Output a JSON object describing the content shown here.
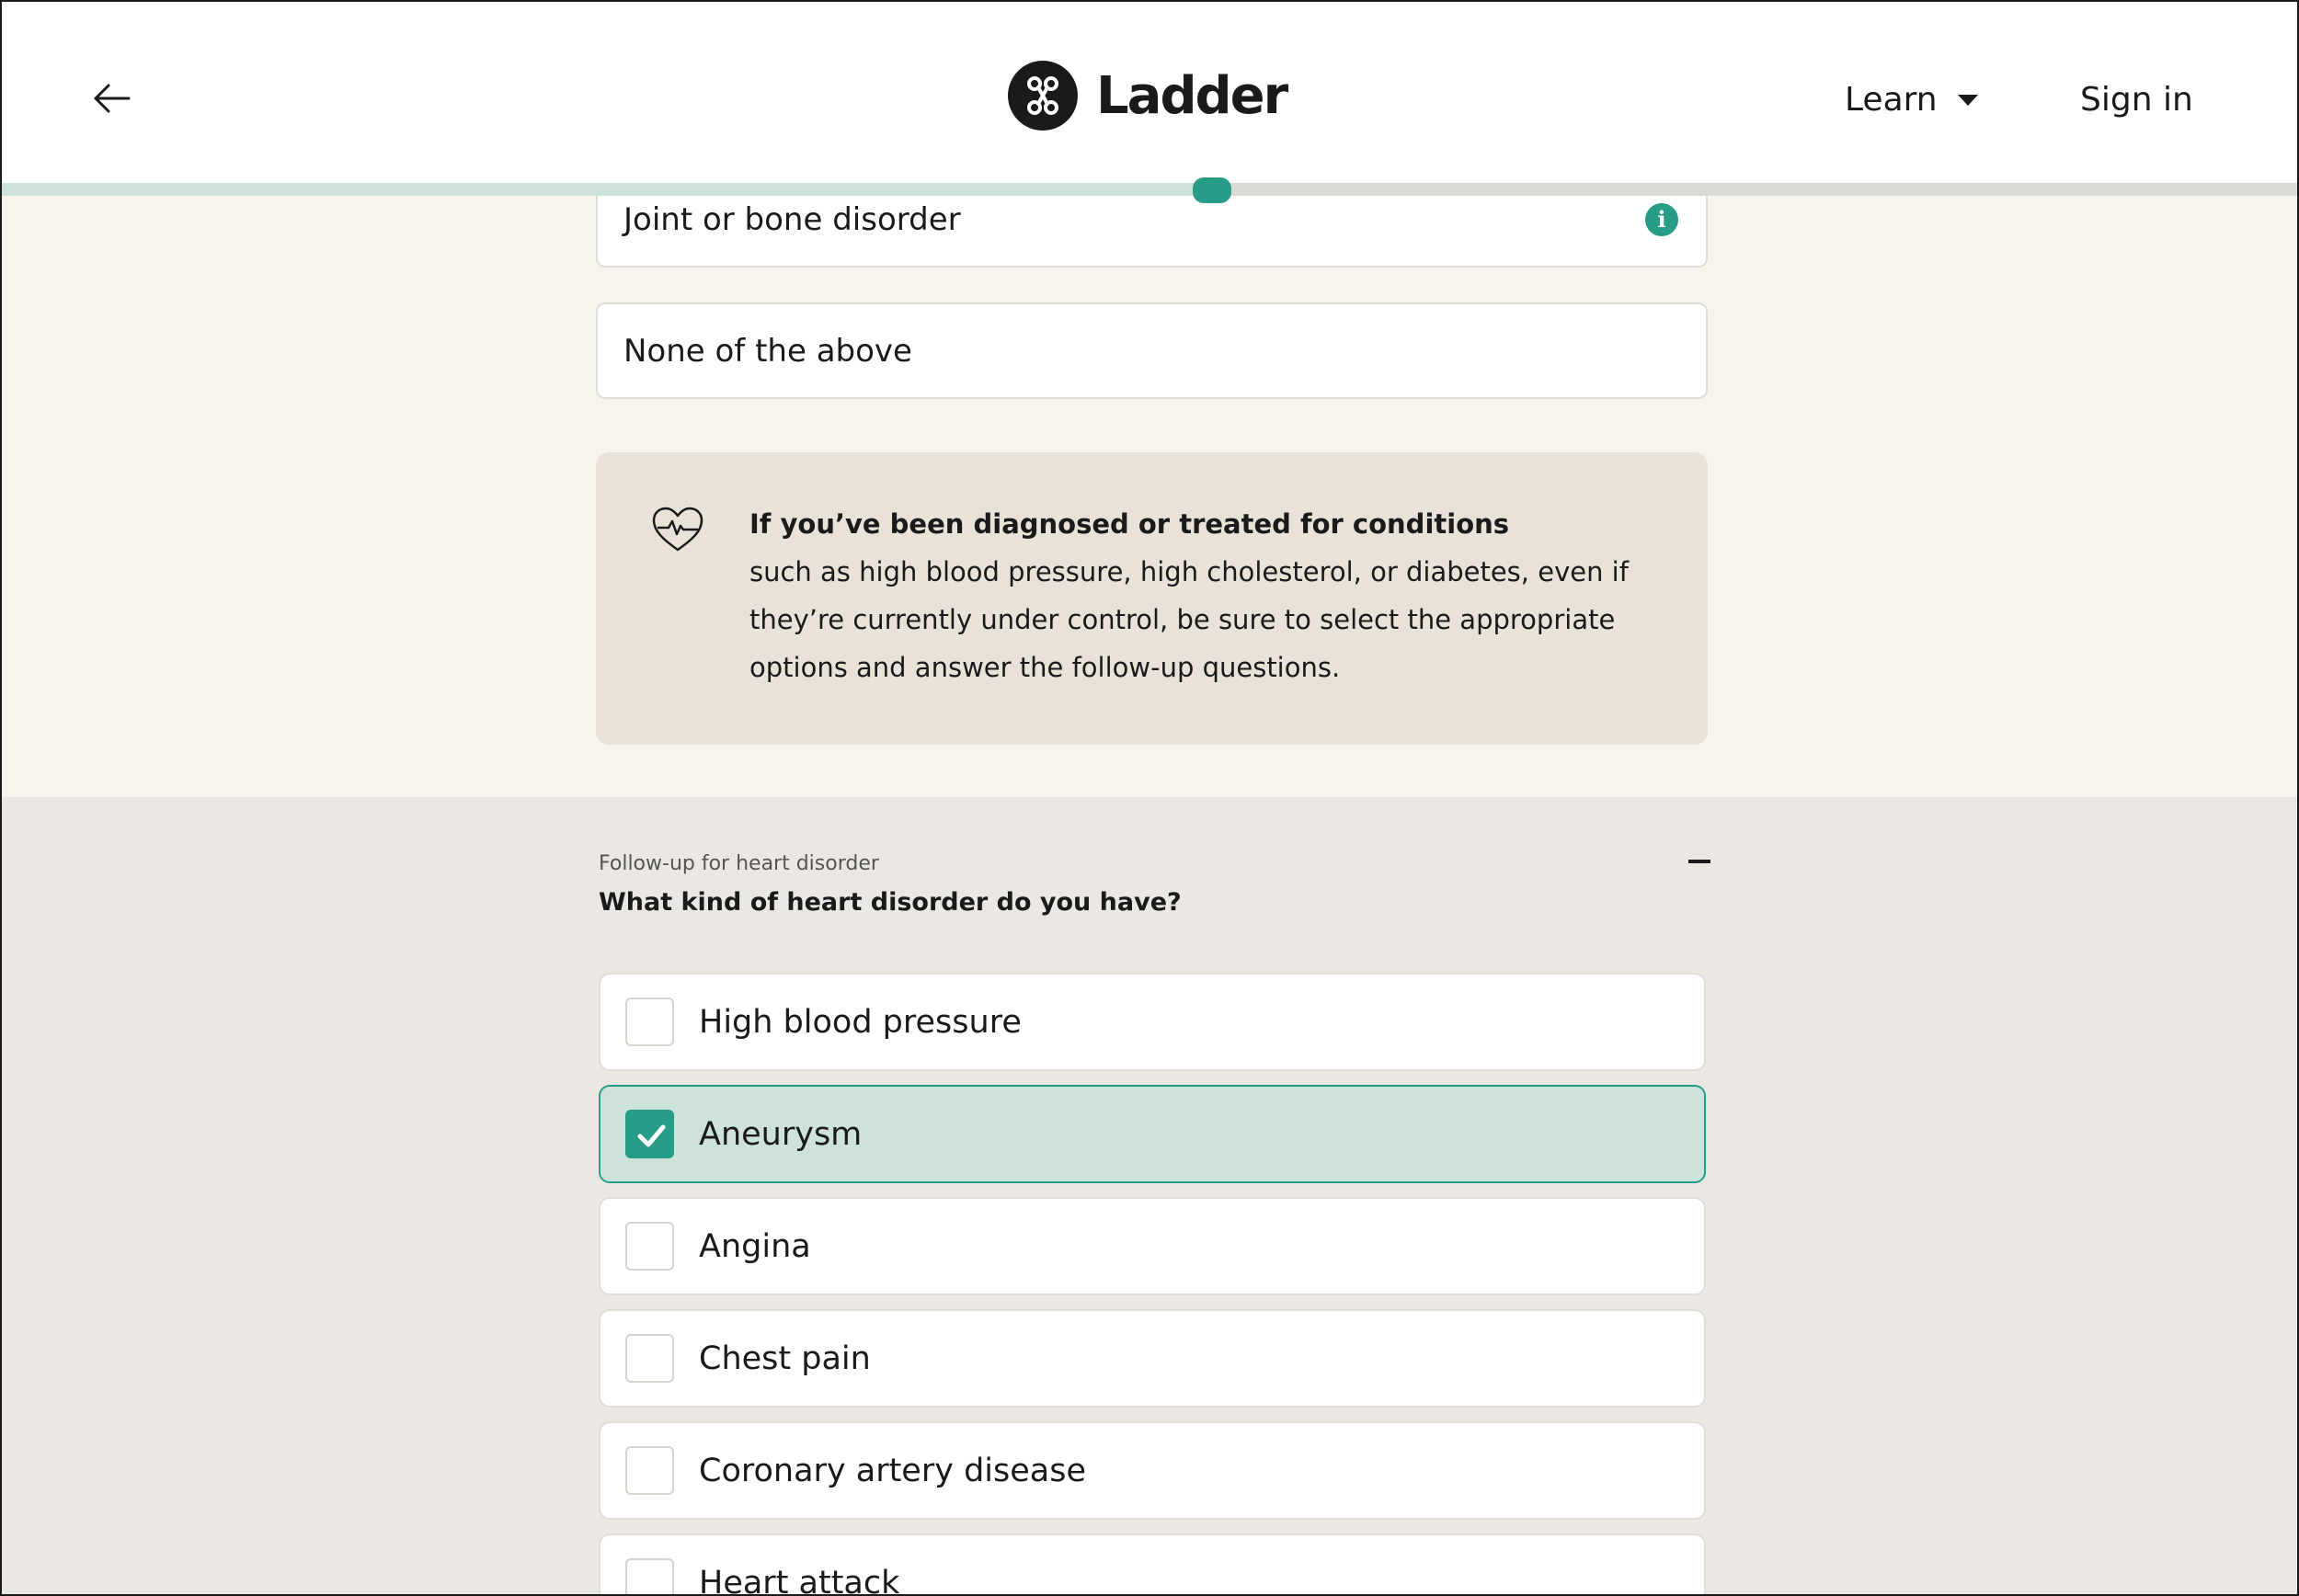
{
  "header": {
    "brand": "Ladder",
    "nav_learn": "Learn",
    "nav_signin": "Sign in"
  },
  "progress": {
    "fraction": 0.527
  },
  "conditions": {
    "options": [
      {
        "label": "Joint or bone disorder",
        "has_info": true
      },
      {
        "label": "None of the above",
        "has_info": false
      }
    ]
  },
  "notice": {
    "title": "If you’ve been diagnosed or treated for conditions",
    "body": "such as high blood pressure, high cholesterol, or diabetes, even if they’re currently under control, be sure to select the appropriate options and answer the follow-up questions."
  },
  "followup": {
    "label": "Follow-up for heart disorder",
    "question": "What kind of heart disorder do you have?",
    "choices": [
      {
        "label": "High blood pressure",
        "checked": false
      },
      {
        "label": "Aneurysm",
        "checked": true
      },
      {
        "label": "Angina",
        "checked": false
      },
      {
        "label": "Chest pain",
        "checked": false
      },
      {
        "label": "Coronary artery disease",
        "checked": false
      },
      {
        "label": "Heart attack",
        "checked": false
      }
    ]
  },
  "colors": {
    "accent": "#279d88",
    "selected_bg": "#cde3da",
    "page_bg": "#f7f4ee",
    "section_bg": "#ebe8e3",
    "notice_bg": "#e9e2d9"
  }
}
